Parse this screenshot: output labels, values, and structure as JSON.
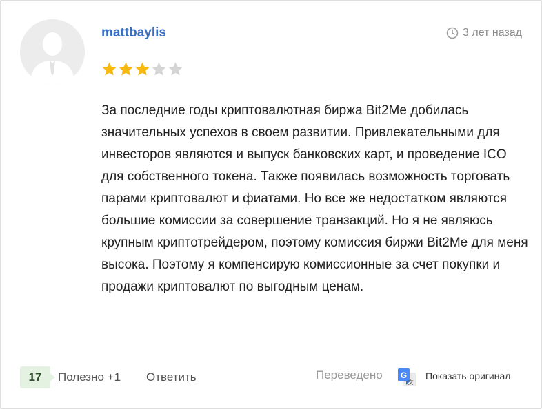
{
  "review": {
    "username": "mattbaylis",
    "time_ago": "3 лет назад",
    "rating": 3,
    "rating_max": 5,
    "text": "За последние годы криптовалютная биржа Bit2Me добилась значительных успехов в своем развитии. Привлекательными для инвесторов являются и выпуск банковских карт, и проведение ICO для собственного токена. Также появилась возможность торговать парами криптовалют и фиатами. Но все же недостатком являются большие комиссии за совершение транзакций. Но я не являюсь крупным криптотрейдером, поэтому комиссия биржи Bit2Me для меня высока. Поэтому я компенсирую комиссионные за счет покупки и продажи криптовалют по выгодным ценам."
  },
  "footer": {
    "vote_count": "17",
    "useful_label": "Полезно +1",
    "reply_label": "Ответить",
    "translated_label": "Переведено",
    "show_original_label": "Показать оригинал"
  },
  "colors": {
    "username": "#3a6fc4",
    "star_filled": "#f5b90f",
    "star_empty": "#d5d5d5",
    "vote_badge_bg": "#e4f3e1"
  },
  "icons": {
    "avatar": "default-user-avatar",
    "time": "clock-icon",
    "translate": "google-translate-icon"
  }
}
